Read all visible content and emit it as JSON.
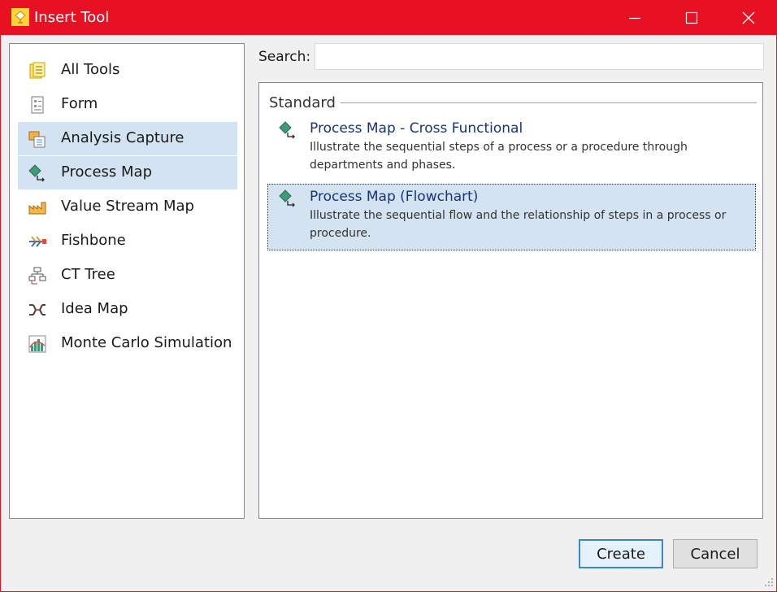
{
  "window": {
    "title": "Insert Tool"
  },
  "sidebar": {
    "items": [
      {
        "label": "All Tools",
        "icon": "all-tools-icon",
        "selected": false
      },
      {
        "label": "Form",
        "icon": "form-icon",
        "selected": false
      },
      {
        "label": "Analysis Capture",
        "icon": "analysis-capture-icon",
        "selected": true
      },
      {
        "label": "Process Map",
        "icon": "process-map-icon",
        "selected": true
      },
      {
        "label": "Value Stream Map",
        "icon": "value-stream-map-icon",
        "selected": false
      },
      {
        "label": "Fishbone",
        "icon": "fishbone-icon",
        "selected": false
      },
      {
        "label": "CT Tree",
        "icon": "ct-tree-icon",
        "selected": false
      },
      {
        "label": "Idea Map",
        "icon": "idea-map-icon",
        "selected": false
      },
      {
        "label": "Monte Carlo Simulation",
        "icon": "monte-carlo-icon",
        "selected": false
      }
    ]
  },
  "search": {
    "label": "Search:",
    "value": "",
    "placeholder": ""
  },
  "main": {
    "group_title": "Standard",
    "tools": [
      {
        "title": "Process Map - Cross Functional",
        "description": "Illustrate the sequential steps of a process or a procedure through departments and phases.",
        "icon": "process-map-icon",
        "selected": false
      },
      {
        "title": "Process Map (Flowchart)",
        "description": "Illustrate the sequential flow and the relationship of steps in a process or procedure.",
        "icon": "process-map-icon",
        "selected": true
      }
    ]
  },
  "buttons": {
    "create": "Create",
    "cancel": "Cancel"
  },
  "colors": {
    "titlebar": "#e81123",
    "selection": "#d4e3f2",
    "tool_title": "#19337a",
    "accent_border": "#3c85cf"
  }
}
